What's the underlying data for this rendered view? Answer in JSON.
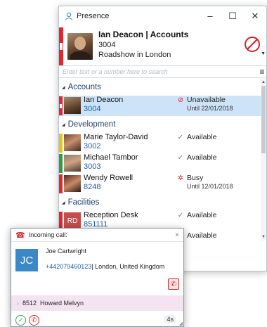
{
  "presence_window": {
    "title": "Presence",
    "controls": {
      "minimize": "–",
      "maximize": "☐",
      "close": "✕"
    },
    "profile": {
      "name_line": "Ian Deacon | Accounts",
      "extension": "3004",
      "note": "Roadshow in London",
      "status_icon": "unavailable-icon"
    },
    "search": {
      "placeholder": "Enter text or a number here to search",
      "value": ""
    },
    "menu_icon": "≡",
    "groups": [
      {
        "name": "Accounts",
        "contacts": [
          {
            "name": "Ian Deacon",
            "number": "3004",
            "status": "Unavailable",
            "status_detail": "Until 22/01/2018",
            "status_icon": "⊘",
            "status_color": "#d92027",
            "strip_color": "#e3262b",
            "selected": true
          }
        ]
      },
      {
        "name": "Development",
        "contacts": [
          {
            "name": "Marie Taylor-David",
            "number": "3002",
            "status": "Available",
            "status_detail": "",
            "status_icon": "✓",
            "status_color": "#3aa24a",
            "strip_color": "#e8c21a"
          },
          {
            "name": "Michael Tambor",
            "number": "3003",
            "status": "Available",
            "status_detail": "",
            "status_icon": "✓",
            "status_color": "#3aa24a",
            "strip_color": "#2e9e44"
          },
          {
            "name": "Wendy Rowell",
            "number": "8248",
            "status": "Busy",
            "status_detail": "Until 12/01/2018",
            "status_icon": "✲",
            "status_color": "#d92027",
            "strip_color": "#e3262b"
          }
        ]
      },
      {
        "name": "Facilities",
        "contacts": [
          {
            "name": "Reception Desk",
            "number": "851111",
            "status": "Available",
            "status_detail": "",
            "status_icon": "✓",
            "status_color": "#3aa24a",
            "strip_color": "#e3262b",
            "initials": "RD"
          },
          {
            "name": "",
            "number": "",
            "status": "Available",
            "status_detail": "",
            "status_icon": "",
            "status_color": "#3aa24a",
            "strip_color": ""
          }
        ]
      }
    ]
  },
  "incoming_call": {
    "title": "Incoming call:",
    "close": "×",
    "caller_initials": "JC",
    "caller_name": "Joe Cartwright",
    "caller_number": "+442079460123",
    "caller_location": "| London, United Kingdom",
    "transfer_extension": "8512",
    "transfer_name": "Howard Melvyn",
    "timer": "4s"
  }
}
